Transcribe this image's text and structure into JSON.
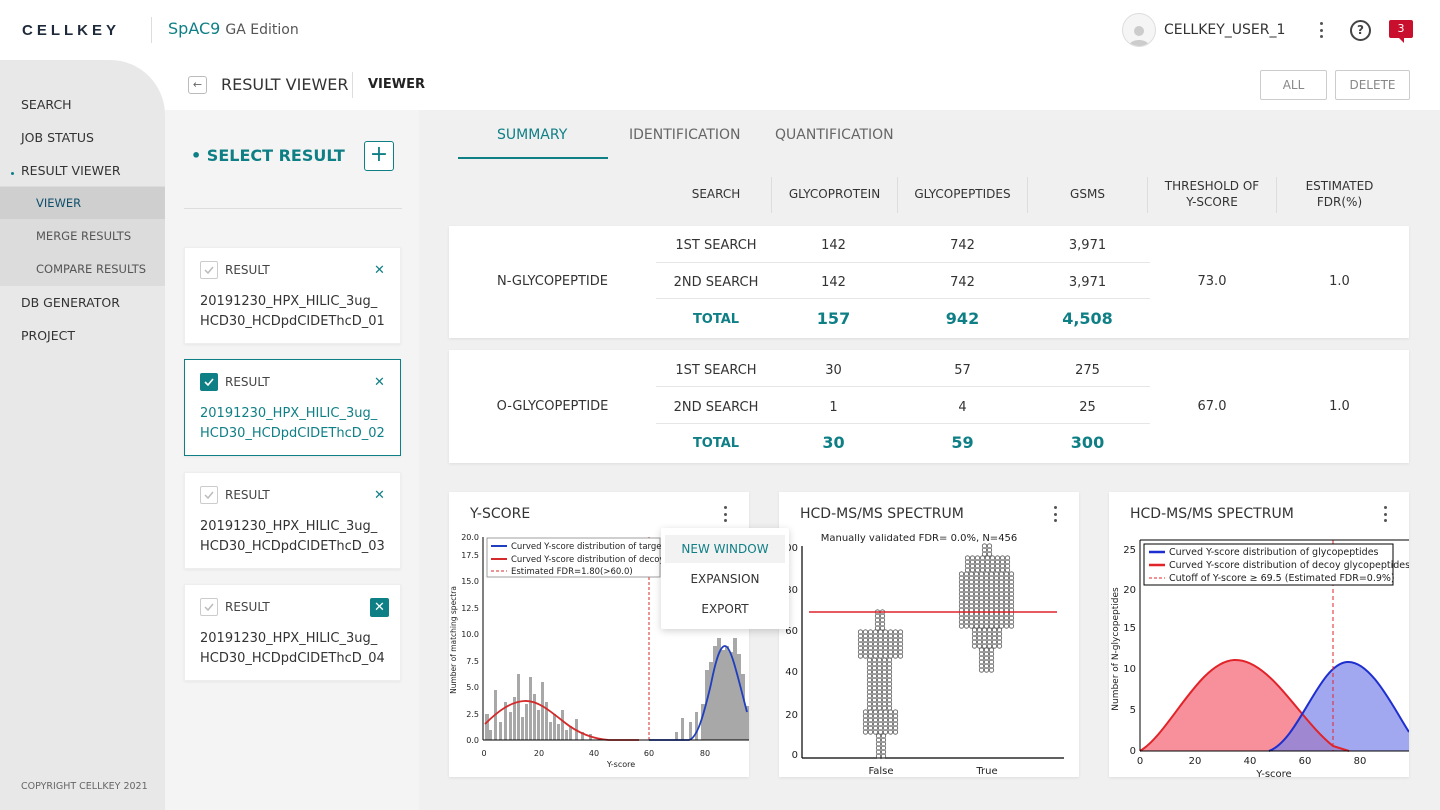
{
  "brand": {
    "logo": "CELLKEY",
    "app_name": "SpAC9",
    "app_edition": "GA Edition"
  },
  "header": {
    "username": "CELLKEY_USER_1",
    "notif_count": "3",
    "help_symbol": "?"
  },
  "sidebar": {
    "items": [
      {
        "label": "SEARCH"
      },
      {
        "label": "JOB STATUS"
      },
      {
        "label": "RESULT VIEWER"
      },
      {
        "label": "VIEWER"
      },
      {
        "label": "MERGE RESULTS"
      },
      {
        "label": "COMPARE RESULTS"
      },
      {
        "label": "DB GENERATOR"
      },
      {
        "label": "PROJECT"
      }
    ],
    "copyright": "COPYRIGHT CELLKEY 2021"
  },
  "page": {
    "title": "RESULT VIEWER",
    "breadcrumb": "VIEWER",
    "all_button": "ALL",
    "delete_button": "DELETE",
    "back_symbol": "←"
  },
  "select_panel": {
    "title": "• SELECT RESULT",
    "add_symbol": "+"
  },
  "results": [
    {
      "label": "RESULT",
      "name1": "20191230_HPX_HILIC_3ug_",
      "name2": "HCD30_HCDpdCIDEThcD_01"
    },
    {
      "label": "RESULT",
      "name1": "20191230_HPX_HILIC_3ug_",
      "name2": "HCD30_HCDpdCIDEThcD_02"
    },
    {
      "label": "RESULT",
      "name1": "20191230_HPX_HILIC_3ug_",
      "name2": "HCD30_HCDpdCIDEThcD_03"
    },
    {
      "label": "RESULT",
      "name1": "20191230_HPX_HILIC_3ug_",
      "name2": "HCD30_HCDpdCIDEThcD_04"
    }
  ],
  "tabs": [
    {
      "label": "SUMMARY"
    },
    {
      "label": "IDENTIFICATION"
    },
    {
      "label": "QUANTIFICATION"
    }
  ],
  "table": {
    "headers": {
      "search": "SEARCH",
      "glycoprotein": "GLYCOPROTEIN",
      "glycopeptides": "GLYCOPEPTIDES",
      "gsms": "GSMS",
      "threshold1": "THRESHOLD OF",
      "threshold2": "Y-SCORE",
      "fdr1": "ESTIMATED",
      "fdr2": "FDR(%)"
    },
    "groups": [
      {
        "name": "N-GLYCOPEPTIDE",
        "threshold": "73.0",
        "fdr": "1.0",
        "rows": [
          {
            "search": "1ST SEARCH",
            "glycoprotein": "142",
            "glycopeptides": "742",
            "gsms": "3,971"
          },
          {
            "search": "2ND SEARCH",
            "glycoprotein": "142",
            "glycopeptides": "742",
            "gsms": "3,971"
          },
          {
            "search": "TOTAL",
            "glycoprotein": "157",
            "glycopeptides": "942",
            "gsms": "4,508"
          }
        ]
      },
      {
        "name": "O-GLYCOPEPTIDE",
        "threshold": "67.0",
        "fdr": "1.0",
        "rows": [
          {
            "search": "1ST SEARCH",
            "glycoprotein": "30",
            "glycopeptides": "57",
            "gsms": "275"
          },
          {
            "search": "2ND SEARCH",
            "glycoprotein": "1",
            "glycopeptides": "4",
            "gsms": "25"
          },
          {
            "search": "TOTAL",
            "glycoprotein": "30",
            "glycopeptides": "59",
            "gsms": "300"
          }
        ]
      }
    ]
  },
  "charts": [
    {
      "title": "Y-SCORE",
      "ylabel": "Number of matching spectra",
      "xlabel": "Y-score",
      "legend": [
        "Curved Y-score distribution of targets",
        "Curved Y-score distribution of decoys",
        "Estimated FDR=1.80(>60.0)"
      ],
      "yticks": [
        "0.0",
        "2.5",
        "5.0",
        "7.5",
        "10.0",
        "12.5",
        "15.0",
        "17.5",
        "20.0"
      ],
      "xticks": [
        "0",
        "20",
        "40",
        "60",
        "80"
      ]
    },
    {
      "title": "HCD-MS/MS SPECTRUM",
      "subtitle": "Manually validated FDR= 0.0%, N=456",
      "yticks": [
        "0",
        "20",
        "40",
        "60",
        "80",
        "100"
      ],
      "xticks": [
        "False",
        "True"
      ]
    },
    {
      "title": "HCD-MS/MS SPECTRUM",
      "ylabel": "Number of N-glycopeptides",
      "xlabel": "Y-score",
      "legend": [
        "Curved Y-score distribution of glycopeptides",
        "Curved Y-score distribution of decoy glycopeptides",
        "Cutoff of Y-score ≥ 69.5 (Estimated FDR=0.9%)"
      ],
      "yticks": [
        "0",
        "5",
        "10",
        "15",
        "20",
        "25"
      ],
      "xticks": [
        "0",
        "20",
        "40",
        "60",
        "80"
      ]
    }
  ],
  "context_menu": [
    {
      "label": "NEW WINDOW"
    },
    {
      "label": "EXPANSION"
    },
    {
      "label": "EXPORT"
    }
  ],
  "colors": {
    "accent": "#0f7f86",
    "badge": "#c8102e",
    "target_curve": "#1f3fbf",
    "decoy_curve": "#d42a2a"
  }
}
